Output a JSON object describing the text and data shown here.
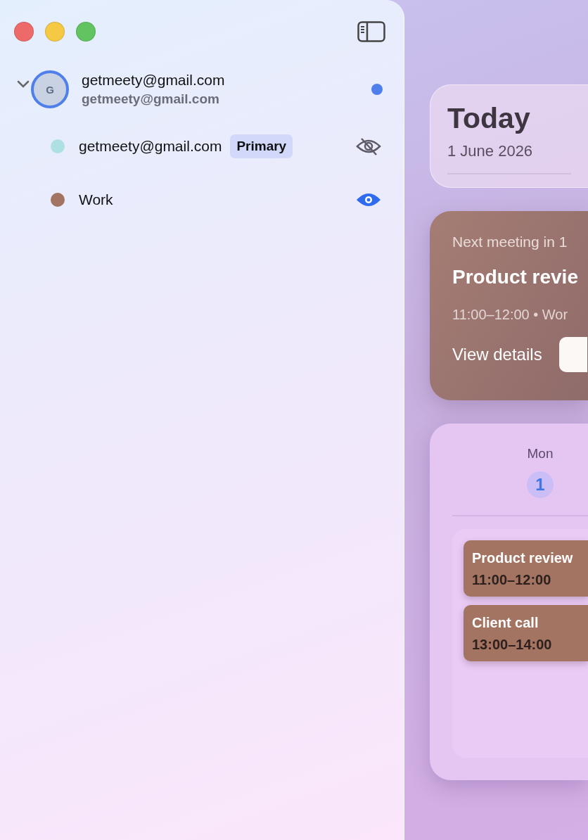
{
  "sidebar": {
    "account": {
      "avatar_letter": "G",
      "name": "getmeety@gmail.com",
      "email": "getmeety@gmail.com",
      "expanded": true,
      "active": true
    },
    "calendars": [
      {
        "name": "getmeety@gmail.com",
        "badge": "Primary",
        "color": "#addfe3",
        "visible": false
      },
      {
        "name": "Work",
        "color": "#a37461",
        "visible": true
      }
    ]
  },
  "main": {
    "today": {
      "title": "Today",
      "date": "1 June 2026"
    },
    "next_meeting": {
      "label": "Next meeting in 1",
      "title": "Product revie",
      "meta": "11:00–12:00 • Wor",
      "action": "View details"
    },
    "day": {
      "weekday": "Mon",
      "number": "1",
      "today": true,
      "events": [
        {
          "title": "Product review",
          "time": "11:00–12:00",
          "color": "#a37461"
        },
        {
          "title": "Client call",
          "time": "13:00–14:00",
          "color": "#a37461"
        }
      ]
    }
  }
}
